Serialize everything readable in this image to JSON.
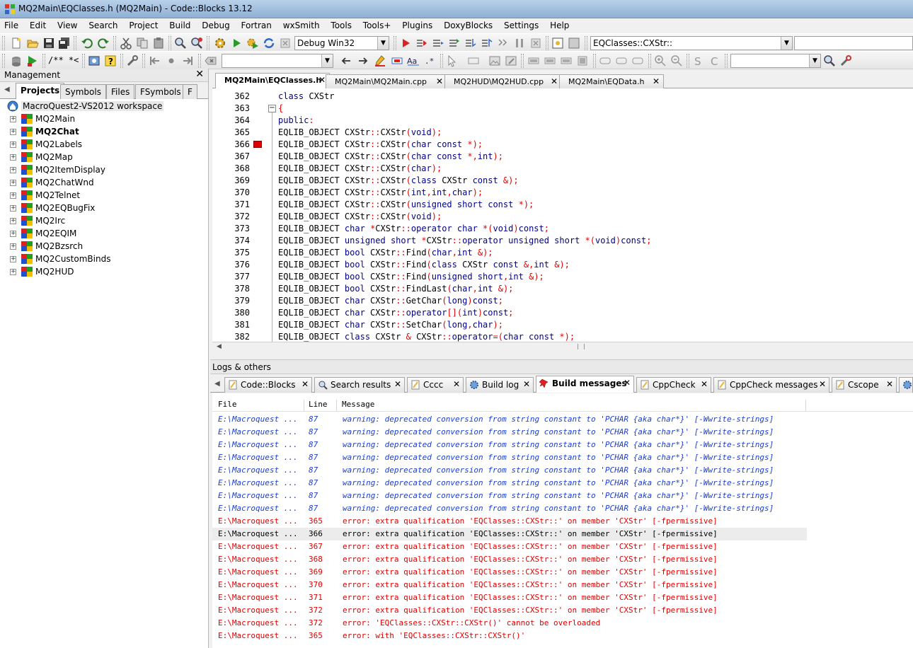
{
  "window": {
    "title": "MQ2Main\\EQClasses.h (MQ2Main) - Code::Blocks 13.12"
  },
  "menu": [
    "File",
    "Edit",
    "View",
    "Search",
    "Project",
    "Build",
    "Debug",
    "Fortran",
    "wxSmith",
    "Tools",
    "Tools+",
    "Plugins",
    "DoxyBlocks",
    "Settings",
    "Help"
  ],
  "toolbar": {
    "build_target": "Debug Win32",
    "symbol_combo": "EQClasses::CXStr::",
    "comment_label": "/** *<"
  },
  "management": {
    "title": "Management",
    "tabs": [
      "Projects",
      "Symbols",
      "Files",
      "FSymbols",
      "F"
    ],
    "workspace": "MacroQuest2-VS2012 workspace",
    "projects": [
      "MQ2Main",
      "MQ2Chat",
      "MQ2Labels",
      "MQ2Map",
      "MQ2ItemDisplay",
      "MQ2ChatWnd",
      "MQ2Telnet",
      "MQ2EQBugFix",
      "MQ2Irc",
      "MQ2EQIM",
      "MQ2Bzsrch",
      "MQ2CustomBinds",
      "MQ2HUD"
    ],
    "active_project": "MQ2Chat"
  },
  "editor": {
    "tabs": [
      "MQ2Main\\EQClasses.h",
      "MQ2Main\\MQ2Main.cpp",
      "MQ2HUD\\MQ2HUD.cpp",
      "MQ2Main\\EQData.h"
    ],
    "line_numbers": [
      "362",
      "363",
      "364",
      "365",
      "366",
      "367",
      "368",
      "369",
      "370",
      "371",
      "372",
      "373",
      "374",
      "375",
      "376",
      "377",
      "378",
      "379",
      "380",
      "381",
      "382"
    ],
    "breakpoint_line": "366",
    "lines": [
      [
        [
          "kw",
          "class"
        ],
        [
          "t",
          " CXStr"
        ]
      ],
      [
        [
          "op",
          "{"
        ]
      ],
      [
        [
          "kw",
          "public"
        ],
        [
          "op",
          ":"
        ]
      ],
      [
        [
          "t",
          "EQLIB_OBJECT CXStr"
        ],
        [
          "op",
          "::"
        ],
        [
          "t",
          "CXStr"
        ],
        [
          "op",
          "("
        ],
        [
          "kw",
          "void"
        ],
        [
          "op",
          ");"
        ]
      ],
      [
        [
          "t",
          "EQLIB_OBJECT CXStr"
        ],
        [
          "op",
          "::"
        ],
        [
          "t",
          "CXStr"
        ],
        [
          "op",
          "("
        ],
        [
          "kw",
          "char const"
        ],
        [
          "t",
          " "
        ],
        [
          "op",
          "*);"
        ]
      ],
      [
        [
          "t",
          "EQLIB_OBJECT CXStr"
        ],
        [
          "op",
          "::"
        ],
        [
          "t",
          "CXStr"
        ],
        [
          "op",
          "("
        ],
        [
          "kw",
          "char const"
        ],
        [
          "t",
          " "
        ],
        [
          "op",
          "*,"
        ],
        [
          "kw",
          "int"
        ],
        [
          "op",
          ");"
        ]
      ],
      [
        [
          "t",
          "EQLIB_OBJECT CXStr"
        ],
        [
          "op",
          "::"
        ],
        [
          "t",
          "CXStr"
        ],
        [
          "op",
          "("
        ],
        [
          "kw",
          "char"
        ],
        [
          "op",
          ");"
        ]
      ],
      [
        [
          "t",
          "EQLIB_OBJECT CXStr"
        ],
        [
          "op",
          "::"
        ],
        [
          "t",
          "CXStr"
        ],
        [
          "op",
          "("
        ],
        [
          "kw",
          "class"
        ],
        [
          "t",
          " CXStr "
        ],
        [
          "kw",
          "const"
        ],
        [
          "t",
          " "
        ],
        [
          "op",
          "&);"
        ]
      ],
      [
        [
          "t",
          "EQLIB_OBJECT CXStr"
        ],
        [
          "op",
          "::"
        ],
        [
          "t",
          "CXStr"
        ],
        [
          "op",
          "("
        ],
        [
          "kw",
          "int"
        ],
        [
          "op",
          ","
        ],
        [
          "kw",
          "int"
        ],
        [
          "op",
          ","
        ],
        [
          "kw",
          "char"
        ],
        [
          "op",
          ");"
        ]
      ],
      [
        [
          "t",
          "EQLIB_OBJECT CXStr"
        ],
        [
          "op",
          "::"
        ],
        [
          "t",
          "CXStr"
        ],
        [
          "op",
          "("
        ],
        [
          "kw",
          "unsigned short const"
        ],
        [
          "t",
          " "
        ],
        [
          "op",
          "*);"
        ]
      ],
      [
        [
          "t",
          "EQLIB_OBJECT CXStr"
        ],
        [
          "op",
          "::"
        ],
        [
          "t",
          "CXStr"
        ],
        [
          "op",
          "("
        ],
        [
          "kw",
          "void"
        ],
        [
          "op",
          ");"
        ]
      ],
      [
        [
          "t",
          "EQLIB_OBJECT "
        ],
        [
          "kw",
          "char"
        ],
        [
          "t",
          " "
        ],
        [
          "op",
          "*"
        ],
        [
          "t",
          "CXStr"
        ],
        [
          "op",
          "::"
        ],
        [
          "kw",
          "operator char"
        ],
        [
          "t",
          " "
        ],
        [
          "op",
          "*("
        ],
        [
          "kw",
          "void"
        ],
        [
          "op",
          ")"
        ],
        [
          "kw",
          "const"
        ],
        [
          "op",
          ";"
        ]
      ],
      [
        [
          "t",
          "EQLIB_OBJECT "
        ],
        [
          "kw",
          "unsigned short"
        ],
        [
          "t",
          " "
        ],
        [
          "op",
          "*"
        ],
        [
          "t",
          "CXStr"
        ],
        [
          "op",
          "::"
        ],
        [
          "kw",
          "operator unsigned short"
        ],
        [
          "t",
          " "
        ],
        [
          "op",
          "*("
        ],
        [
          "kw",
          "void"
        ],
        [
          "op",
          ")"
        ],
        [
          "kw",
          "const"
        ],
        [
          "op",
          ";"
        ]
      ],
      [
        [
          "t",
          "EQLIB_OBJECT "
        ],
        [
          "kw",
          "bool"
        ],
        [
          "t",
          " CXStr"
        ],
        [
          "op",
          "::"
        ],
        [
          "t",
          "Find"
        ],
        [
          "op",
          "("
        ],
        [
          "kw",
          "char"
        ],
        [
          "op",
          ","
        ],
        [
          "kw",
          "int"
        ],
        [
          "t",
          " "
        ],
        [
          "op",
          "&);"
        ]
      ],
      [
        [
          "t",
          "EQLIB_OBJECT "
        ],
        [
          "kw",
          "bool"
        ],
        [
          "t",
          " CXStr"
        ],
        [
          "op",
          "::"
        ],
        [
          "t",
          "Find"
        ],
        [
          "op",
          "("
        ],
        [
          "kw",
          "class"
        ],
        [
          "t",
          " CXStr "
        ],
        [
          "kw",
          "const"
        ],
        [
          "t",
          " "
        ],
        [
          "op",
          "&,"
        ],
        [
          "kw",
          "int"
        ],
        [
          "t",
          " "
        ],
        [
          "op",
          "&);"
        ]
      ],
      [
        [
          "t",
          "EQLIB_OBJECT "
        ],
        [
          "kw",
          "bool"
        ],
        [
          "t",
          " CXStr"
        ],
        [
          "op",
          "::"
        ],
        [
          "t",
          "Find"
        ],
        [
          "op",
          "("
        ],
        [
          "kw",
          "unsigned short"
        ],
        [
          "op",
          ","
        ],
        [
          "kw",
          "int"
        ],
        [
          "t",
          " "
        ],
        [
          "op",
          "&);"
        ]
      ],
      [
        [
          "t",
          "EQLIB_OBJECT "
        ],
        [
          "kw",
          "bool"
        ],
        [
          "t",
          " CXStr"
        ],
        [
          "op",
          "::"
        ],
        [
          "t",
          "FindLast"
        ],
        [
          "op",
          "("
        ],
        [
          "kw",
          "char"
        ],
        [
          "op",
          ","
        ],
        [
          "kw",
          "int"
        ],
        [
          "t",
          " "
        ],
        [
          "op",
          "&);"
        ]
      ],
      [
        [
          "t",
          "EQLIB_OBJECT "
        ],
        [
          "kw",
          "char"
        ],
        [
          "t",
          " CXStr"
        ],
        [
          "op",
          "::"
        ],
        [
          "t",
          "GetChar"
        ],
        [
          "op",
          "("
        ],
        [
          "kw",
          "long"
        ],
        [
          "op",
          ")"
        ],
        [
          "kw",
          "const"
        ],
        [
          "op",
          ";"
        ]
      ],
      [
        [
          "t",
          "EQLIB_OBJECT "
        ],
        [
          "kw",
          "char"
        ],
        [
          "t",
          " CXStr"
        ],
        [
          "op",
          "::"
        ],
        [
          "kw",
          "operator"
        ],
        [
          "op",
          "[]("
        ],
        [
          "kw",
          "int"
        ],
        [
          "op",
          ")"
        ],
        [
          "kw",
          "const"
        ],
        [
          "op",
          ";"
        ]
      ],
      [
        [
          "t",
          "EQLIB_OBJECT "
        ],
        [
          "kw",
          "char"
        ],
        [
          "t",
          " CXStr"
        ],
        [
          "op",
          "::"
        ],
        [
          "t",
          "SetChar"
        ],
        [
          "op",
          "("
        ],
        [
          "kw",
          "long"
        ],
        [
          "op",
          ","
        ],
        [
          "kw",
          "char"
        ],
        [
          "op",
          ");"
        ]
      ],
      [
        [
          "t",
          "EQLIB_OBJECT "
        ],
        [
          "kw",
          "class"
        ],
        [
          "t",
          " CXStr "
        ],
        [
          "op",
          "&"
        ],
        [
          "t",
          " CXStr"
        ],
        [
          "op",
          "::"
        ],
        [
          "kw",
          "operator"
        ],
        [
          "op",
          "=("
        ],
        [
          "kw",
          "char const"
        ],
        [
          "t",
          " "
        ],
        [
          "op",
          "*);"
        ]
      ]
    ]
  },
  "logs": {
    "title": "Logs & others",
    "tabs": [
      "Code::Blocks",
      "Search results",
      "Cccc",
      "Build log",
      "Build messages",
      "CppCheck",
      "CppCheck messages",
      "Cscope"
    ],
    "active_tab": "Build messages",
    "columns": [
      "File",
      "Line",
      "Message"
    ],
    "rows": [
      {
        "type": "warning",
        "file": "E:\\Macroquest ...",
        "line": "87",
        "message": "warning: deprecated conversion from string constant to 'PCHAR {aka char*}' [-Wwrite-strings]"
      },
      {
        "type": "warning",
        "file": "E:\\Macroquest ...",
        "line": "87",
        "message": "warning: deprecated conversion from string constant to 'PCHAR {aka char*}' [-Wwrite-strings]"
      },
      {
        "type": "warning",
        "file": "E:\\Macroquest ...",
        "line": "87",
        "message": "warning: deprecated conversion from string constant to 'PCHAR {aka char*}' [-Wwrite-strings]"
      },
      {
        "type": "warning",
        "file": "E:\\Macroquest ...",
        "line": "87",
        "message": "warning: deprecated conversion from string constant to 'PCHAR {aka char*}' [-Wwrite-strings]"
      },
      {
        "type": "warning",
        "file": "E:\\Macroquest ...",
        "line": "87",
        "message": "warning: deprecated conversion from string constant to 'PCHAR {aka char*}' [-Wwrite-strings]"
      },
      {
        "type": "warning",
        "file": "E:\\Macroquest ...",
        "line": "87",
        "message": "warning: deprecated conversion from string constant to 'PCHAR {aka char*}' [-Wwrite-strings]"
      },
      {
        "type": "warning",
        "file": "E:\\Macroquest ...",
        "line": "87",
        "message": "warning: deprecated conversion from string constant to 'PCHAR {aka char*}' [-Wwrite-strings]"
      },
      {
        "type": "warning",
        "file": "E:\\Macroquest ...",
        "line": "87",
        "message": "warning: deprecated conversion from string constant to 'PCHAR {aka char*}' [-Wwrite-strings]"
      },
      {
        "type": "error",
        "file": "E:\\Macroquest ...",
        "line": "365",
        "message": "error: extra qualification 'EQClasses::CXStr::' on member 'CXStr' [-fpermissive]"
      },
      {
        "type": "selected",
        "file": "E:\\Macroquest ...",
        "line": "366",
        "message": "error: extra qualification 'EQClasses::CXStr::' on member 'CXStr' [-fpermissive]"
      },
      {
        "type": "error",
        "file": "E:\\Macroquest ...",
        "line": "367",
        "message": "error: extra qualification 'EQClasses::CXStr::' on member 'CXStr' [-fpermissive]"
      },
      {
        "type": "error",
        "file": "E:\\Macroquest ...",
        "line": "368",
        "message": "error: extra qualification 'EQClasses::CXStr::' on member 'CXStr' [-fpermissive]"
      },
      {
        "type": "error",
        "file": "E:\\Macroquest ...",
        "line": "369",
        "message": "error: extra qualification 'EQClasses::CXStr::' on member 'CXStr' [-fpermissive]"
      },
      {
        "type": "error",
        "file": "E:\\Macroquest ...",
        "line": "370",
        "message": "error: extra qualification 'EQClasses::CXStr::' on member 'CXStr' [-fpermissive]"
      },
      {
        "type": "error",
        "file": "E:\\Macroquest ...",
        "line": "371",
        "message": "error: extra qualification 'EQClasses::CXStr::' on member 'CXStr' [-fpermissive]"
      },
      {
        "type": "error",
        "file": "E:\\Macroquest ...",
        "line": "372",
        "message": "error: extra qualification 'EQClasses::CXStr::' on member 'CXStr' [-fpermissive]"
      },
      {
        "type": "error",
        "file": "E:\\Macroquest ...",
        "line": "372",
        "message": "error: 'EQClasses::CXStr::CXStr()' cannot be overloaded"
      },
      {
        "type": "error",
        "file": "E:\\Macroquest ...",
        "line": "365",
        "message": "error: with 'EQClasses::CXStr::CXStr()'"
      }
    ]
  }
}
